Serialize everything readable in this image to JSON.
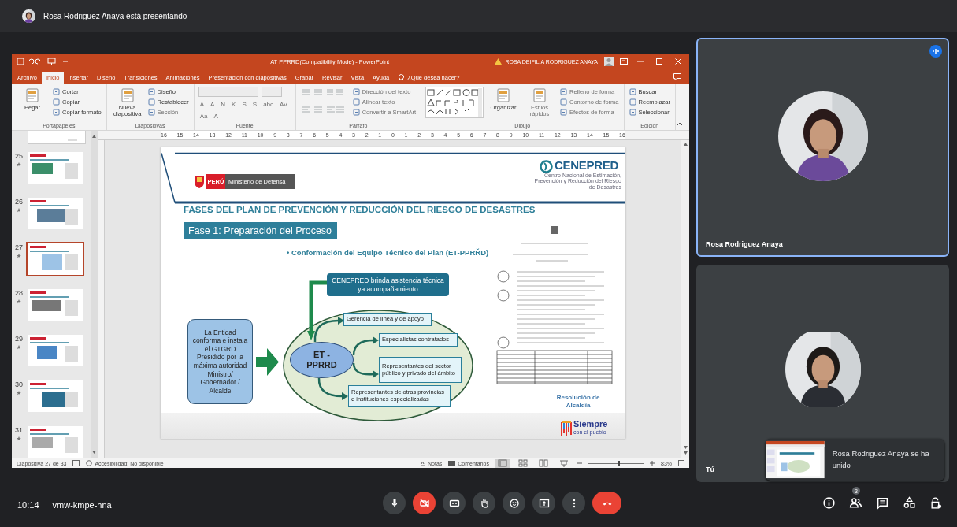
{
  "presenting_banner": {
    "text": "Rosa Rodriguez Anaya está presentando"
  },
  "powerpoint": {
    "title": "AT PPRRD(Compatibility Mode) - PowerPoint",
    "account": "ROSA DEIFILIA RODRIGUEZ ANAYA",
    "tabs": [
      {
        "label": "Archivo",
        "selected": false
      },
      {
        "label": "Inicio",
        "selected": true
      },
      {
        "label": "Insertar",
        "selected": false
      },
      {
        "label": "Diseño",
        "selected": false
      },
      {
        "label": "Transiciones",
        "selected": false
      },
      {
        "label": "Animaciones",
        "selected": false
      },
      {
        "label": "Presentación con diapositivas",
        "selected": false
      },
      {
        "label": "Grabar",
        "selected": false
      },
      {
        "label": "Revisar",
        "selected": false
      },
      {
        "label": "Vista",
        "selected": false
      },
      {
        "label": "Ayuda",
        "selected": false
      }
    ],
    "tell_me": "¿Qué desea hacer?",
    "ribbon": [
      {
        "label": "Portapapeles",
        "items": [
          {
            "kind": "large",
            "label": "Pegar",
            "disabled": false
          },
          {
            "kind": "small",
            "label": "Cortar",
            "disabled": false
          },
          {
            "kind": "small",
            "label": "Copiar",
            "disabled": false
          },
          {
            "kind": "small",
            "label": "Copiar formato",
            "disabled": false
          }
        ]
      },
      {
        "label": "Diapositivas",
        "items": [
          {
            "kind": "large",
            "label": "Nueva diapositiva",
            "disabled": false
          },
          {
            "kind": "small",
            "label": "Diseño",
            "disabled": false
          },
          {
            "kind": "small",
            "label": "Restablecer",
            "disabled": false
          },
          {
            "kind": "small",
            "label": "Sección",
            "disabled": true
          }
        ]
      },
      {
        "label": "Fuente",
        "items": [
          {
            "kind": "combo",
            "disabled": true
          },
          {
            "kind": "combo",
            "disabled": true
          },
          {
            "kind": "glyph",
            "label": "A",
            "disabled": true
          },
          {
            "kind": "glyph",
            "label": "A",
            "disabled": true
          },
          {
            "kind": "glyph",
            "label": "N",
            "disabled": true
          },
          {
            "kind": "glyph",
            "label": "K",
            "disabled": true
          },
          {
            "kind": "glyph",
            "label": "S",
            "disabled": true
          },
          {
            "kind": "glyph",
            "label": "S",
            "disabled": true
          },
          {
            "kind": "glyph",
            "label": "abc",
            "disabled": true
          },
          {
            "kind": "glyph",
            "label": "AV",
            "disabled": true
          },
          {
            "kind": "glyph",
            "label": "Aa",
            "disabled": true
          },
          {
            "kind": "glyph",
            "label": "A",
            "disabled": true
          }
        ]
      },
      {
        "label": "Párrafo",
        "items": [
          {
            "kind": "icon_grid",
            "disabled": true
          },
          {
            "kind": "small",
            "label": "Dirección del texto",
            "disabled": true
          },
          {
            "kind": "small",
            "label": "Alinear texto",
            "disabled": true
          },
          {
            "kind": "small",
            "label": "Convertir a SmartArt",
            "disabled": true
          }
        ]
      },
      {
        "label": "Dibujo",
        "items": [
          {
            "kind": "gallery",
            "disabled": false
          },
          {
            "kind": "large",
            "label": "Organizar",
            "disabled": false
          },
          {
            "kind": "large",
            "label": "Estilos rápidos",
            "disabled": true
          },
          {
            "kind": "small",
            "label": "Relleno de forma",
            "disabled": true
          },
          {
            "kind": "small",
            "label": "Contorno de forma",
            "disabled": true
          },
          {
            "kind": "small",
            "label": "Efectos de forma",
            "disabled": true
          }
        ]
      },
      {
        "label": "Edición",
        "items": [
          {
            "kind": "small",
            "label": "Buscar",
            "disabled": false
          },
          {
            "kind": "small",
            "label": "Reemplazar",
            "disabled": false
          },
          {
            "kind": "small",
            "label": "Seleccionar",
            "disabled": false
          }
        ]
      }
    ],
    "ruler": [
      "16",
      "15",
      "14",
      "13",
      "12",
      "11",
      "10",
      "9",
      "8",
      "7",
      "6",
      "5",
      "4",
      "3",
      "2",
      "1",
      "0",
      "1",
      "2",
      "3",
      "4",
      "5",
      "6",
      "7",
      "8",
      "9",
      "10",
      "11",
      "12",
      "13",
      "14",
      "15",
      "16"
    ],
    "thumbnails": [
      {
        "number": "25",
        "selected": false
      },
      {
        "number": "26",
        "selected": false
      },
      {
        "number": "27",
        "selected": true
      },
      {
        "number": "28",
        "selected": false
      },
      {
        "number": "29",
        "selected": false
      },
      {
        "number": "30",
        "selected": false
      },
      {
        "number": "31",
        "selected": false
      }
    ],
    "slide": {
      "country": "PERÚ",
      "ministry": "Ministerio de Defensa",
      "org": "CENEPRED",
      "org_subtitle": "Centro Nacional de Estimación, Prevención y Reducción del Riesgo de Desastres",
      "title": "FASES DEL PLAN DE PREVENCIÓN Y REDUCCIÓN DEL RIESGO DE DESASTRES",
      "phase": "Fase 1: Preparación del Proceso",
      "bullet": "• Conformación del Equipo Técnico del Plan (ET-PPRŘD)",
      "support": "CENEPRED brinda asistencia técnica ya acompañamiento",
      "entity": "La Entidad conforma e instala el GTGRD Presidido por la máxima autoridad Ministro/ Gobernador / Alcalde",
      "center": "ET - PPRRD",
      "members": [
        "Gerencia de línea y de apoyo",
        "Especialistas contratados",
        "Representantes del sector público y privado del ámbito",
        "Representantes de otras provincias e instituciones especializadas"
      ],
      "document_caption": "Resolución de Alcaldía",
      "slogan": "Siempre",
      "slogan_sub": "con el pueblo"
    },
    "status_bar": {
      "slide_count": "Diapositiva 27 de 33",
      "accessibility": "Accesibilidad: No disponible",
      "notes": "Notas",
      "comments": "Comentarios",
      "views": [
        {
          "kind": "normal",
          "selected": true
        },
        {
          "kind": "sorter",
          "selected": false
        },
        {
          "kind": "reading",
          "selected": false
        },
        {
          "kind": "show",
          "selected": false
        }
      ],
      "zoom": {
        "level": 0.55
      },
      "zoom_text": "83%"
    }
  },
  "participants": [
    {
      "name": "Rosa Rodriguez Anaya",
      "active_speaker": true
    },
    {
      "name": "Tú",
      "active_speaker": false
    }
  ],
  "notification": {
    "text": "Rosa Rodriguez Anaya se ha unido"
  },
  "meeting": {
    "time": "10:14",
    "code": "vmw-kmpe-hna"
  },
  "controls": [
    {
      "kind": "mic",
      "on": true
    },
    {
      "kind": "camera",
      "on": false
    },
    {
      "kind": "captions",
      "on": false
    },
    {
      "kind": "hand"
    },
    {
      "kind": "emoji"
    },
    {
      "kind": "present"
    },
    {
      "kind": "more"
    },
    {
      "kind": "leave"
    }
  ],
  "side_controls": [
    {
      "kind": "info"
    },
    {
      "kind": "people",
      "badge": "3"
    },
    {
      "kind": "chat"
    },
    {
      "kind": "activities"
    },
    {
      "kind": "host"
    }
  ]
}
